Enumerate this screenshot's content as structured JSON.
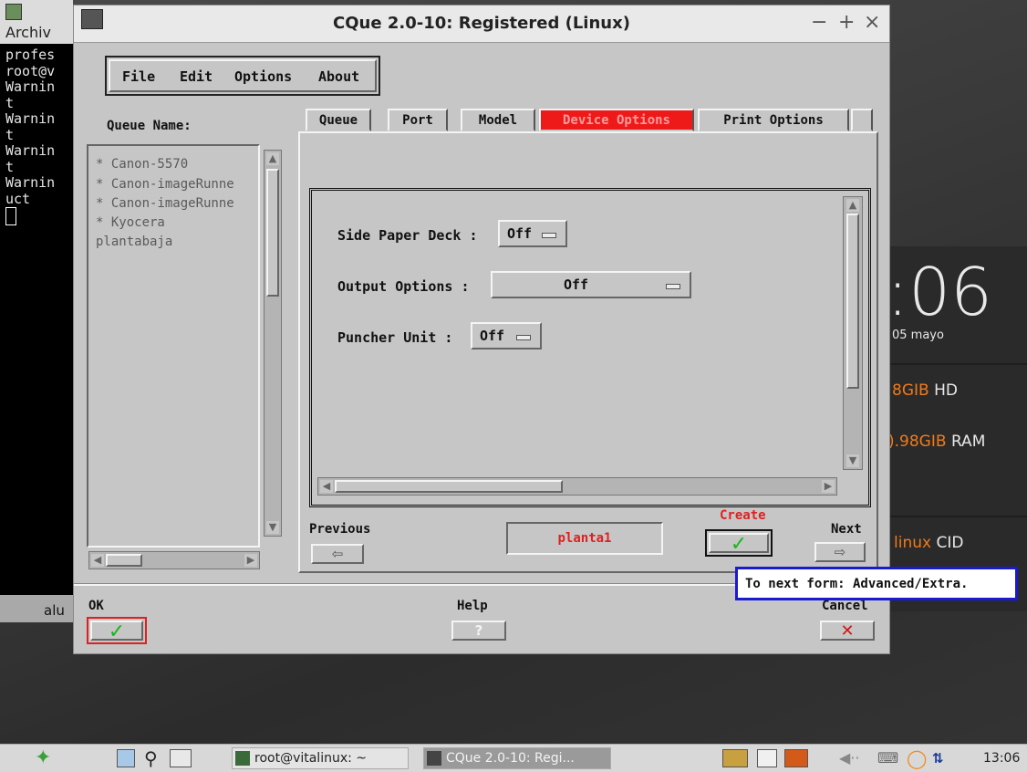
{
  "window": {
    "title": "CQue 2.0-10: Registered (Linux)",
    "controls": {
      "minimize": "−",
      "maximize": "+",
      "close": "×"
    }
  },
  "menubar": [
    "File",
    "Edit",
    "Options",
    "About"
  ],
  "queue": {
    "label": "Queue Name:",
    "items": [
      "* Canon-5570",
      "* Canon-imageRunne",
      "* Canon-imageRunne",
      "* Kyocera",
      "plantabaja"
    ]
  },
  "tabs": [
    {
      "label": "Queue",
      "active": false
    },
    {
      "label": "Port",
      "active": false
    },
    {
      "label": "Model",
      "active": false
    },
    {
      "label": "Device Options",
      "active": true
    },
    {
      "label": "Print Options",
      "active": false
    }
  ],
  "options": {
    "side_paper_deck": {
      "label": "Side Paper Deck :",
      "value": "Off"
    },
    "output_options": {
      "label": "Output Options :",
      "value": "Off"
    },
    "puncher_unit": {
      "label": "Puncher Unit :",
      "value": "Off"
    }
  },
  "nav": {
    "previous_label": "Previous",
    "previous_icon": "⇦",
    "queue_name_value": "planta1",
    "create_label": "Create",
    "create_icon": "✓",
    "next_label": "Next",
    "next_icon": "⇨"
  },
  "footer": {
    "ok_label": "OK",
    "ok_icon": "✓",
    "help_label": "Help",
    "help_icon": "?",
    "cancel_label": "Cancel",
    "cancel_icon": "✕"
  },
  "tooltip": "To next form: Advanced/Extra.",
  "terminal": {
    "menu": "Archiv",
    "lines": [
      "profes",
      "root@v",
      "Warnin",
      "t",
      "Warnin",
      "t",
      "Warnin",
      "t",
      "Warnin",
      "uct"
    ],
    "bottom_text": "alu"
  },
  "desktop": {
    "clock": ":06",
    "date": "05 mayo",
    "hd_value": "8GIB",
    "hd_label": "HD",
    "ram_value": ").98GIB",
    "ram_label": "RAM",
    "distro_name": "linux",
    "distro_suffix": "CID",
    "accent": "#f07a1a"
  },
  "taskbar": {
    "tasks": [
      "root@vitalinux: ~",
      "CQue 2.0-10: Regi..."
    ],
    "clock": "13:06"
  }
}
